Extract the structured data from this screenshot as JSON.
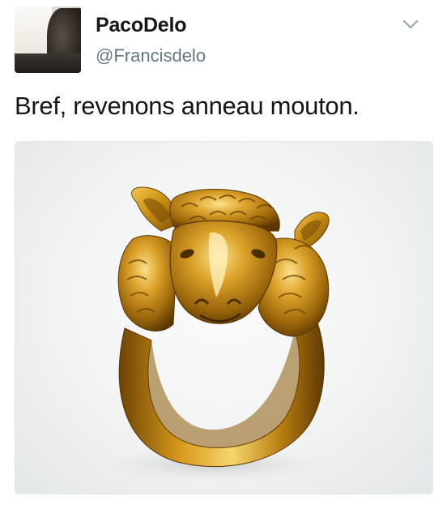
{
  "tweet": {
    "author": {
      "name": "PacoDelo",
      "handle": "@Francisdelo"
    },
    "text": "Bref, revenons anneau mouton.",
    "media": {
      "icon": "ram-head-gold-ring"
    }
  },
  "colors": {
    "text": "#14171a",
    "secondary": "#657786",
    "gold": "#c98f12"
  }
}
